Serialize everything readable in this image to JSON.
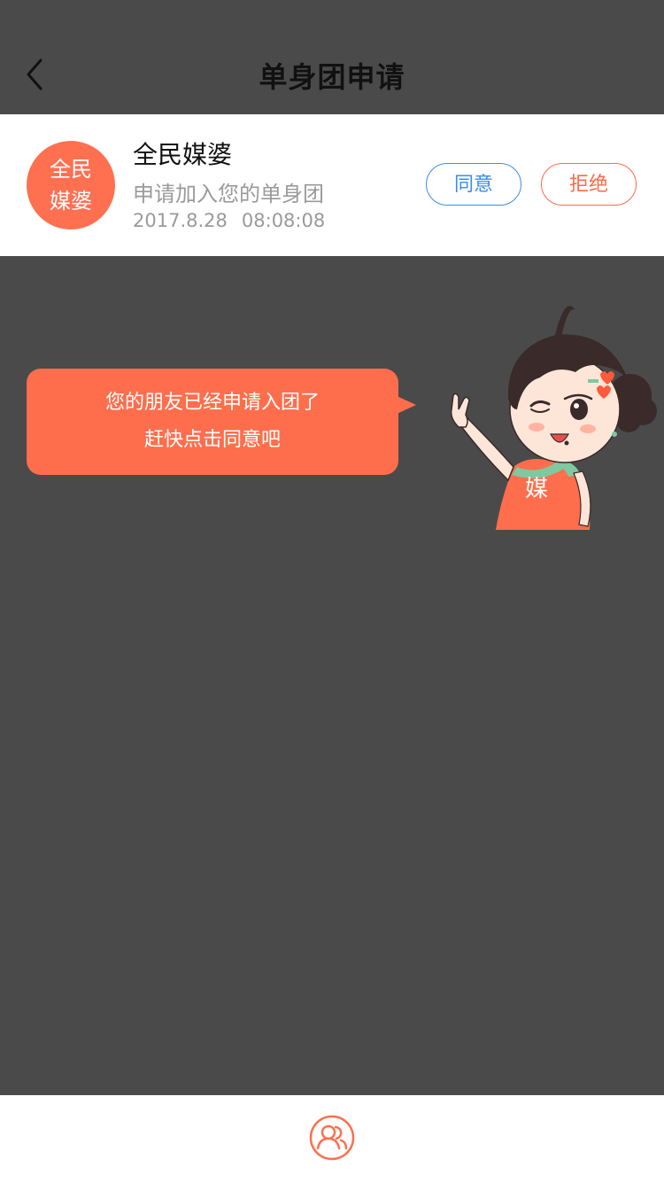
{
  "header": {
    "title": "单身团申请"
  },
  "request": {
    "avatar_line1": "全民",
    "avatar_line2": "媒婆",
    "name": "全民媒婆",
    "message": "申请加入您的单身团",
    "date": "2017.8.28",
    "time": "08:08:08",
    "agree_label": "同意",
    "reject_label": "拒绝"
  },
  "bubble": {
    "line1": "您的朋友已经申请入团了",
    "line2": "赶快点击同意吧"
  },
  "mascot": {
    "badge": "媒"
  },
  "colors": {
    "accent": "#ff6e4c",
    "agree": "#3a8ee6",
    "background": "#4a4a4a"
  },
  "icons": {
    "back": "chevron-left-icon",
    "group": "group-icon"
  }
}
